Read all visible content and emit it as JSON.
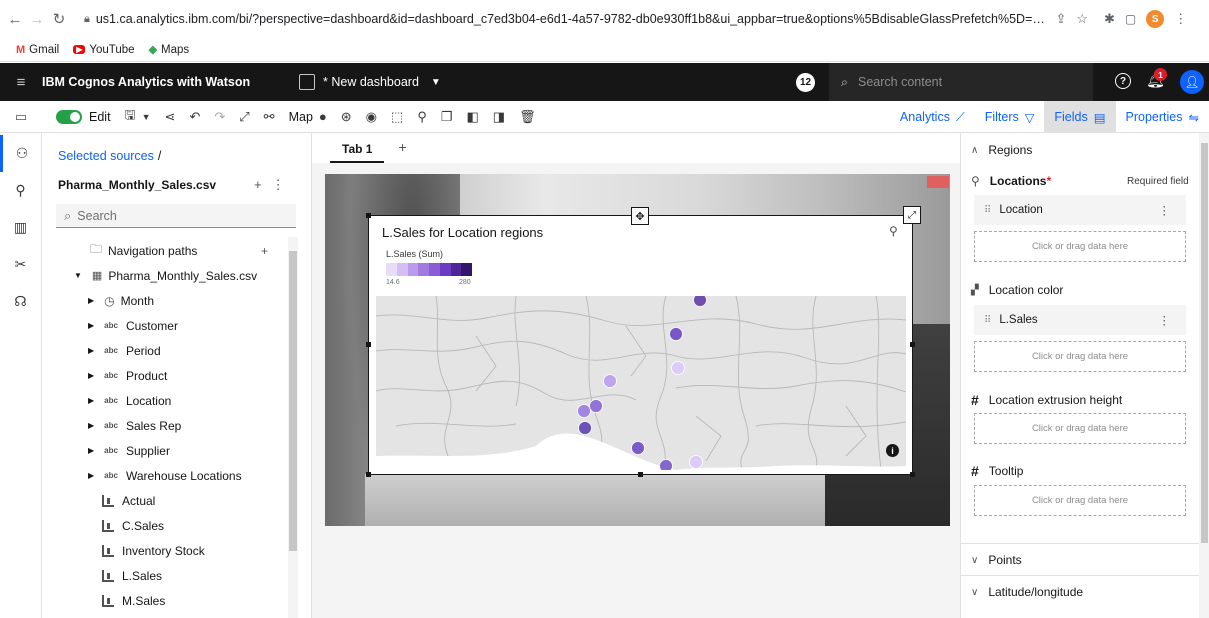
{
  "browser": {
    "url": "us1.ca.analytics.ibm.com/bi/?perspective=dashboard&id=dashboard_c7ed3b04-e6d1-4a57-9782-db0e930ff1b8&ui_appbar=true&options%5BdisableGlassPrefetch%5D=true&options%5Bcol...",
    "bookmarks": [
      {
        "icon": "M",
        "label": "Gmail",
        "color": "#ea4335"
      },
      {
        "icon": "▶",
        "label": "YouTube",
        "color": "#ff0000"
      },
      {
        "icon": "◆",
        "label": "Maps",
        "color": "#34a853"
      }
    ],
    "profile_initial": "S"
  },
  "appbar": {
    "title": "IBM Cognos Analytics with Watson",
    "dashboard_name": "* New dashboard",
    "notifications_count": "12",
    "search_placeholder": "Search content",
    "bell_badge": "1"
  },
  "toolbar": {
    "edit_label": "Edit",
    "map_label": "Map",
    "right_tabs": [
      {
        "label": "Analytics",
        "icon": "chart-line-icon",
        "active": false
      },
      {
        "label": "Filters",
        "icon": "filter-icon",
        "active": false
      },
      {
        "label": "Fields",
        "icon": "fields-icon",
        "active": true
      },
      {
        "label": "Properties",
        "icon": "settings-adjust-icon",
        "active": false
      }
    ]
  },
  "sources": {
    "selected_sources": "Selected sources",
    "file_name": "Pharma_Monthly_Sales.csv",
    "search_placeholder": "Search",
    "tree": [
      {
        "label": "Navigation paths",
        "kind": "folder",
        "indent": 48
      },
      {
        "label": "Pharma_Monthly_Sales.csv",
        "kind": "table",
        "indent": 32
      },
      {
        "label": "Month",
        "kind": "time",
        "indent": 46
      },
      {
        "label": "Customer",
        "kind": "abc",
        "indent": 46
      },
      {
        "label": "Period",
        "kind": "abc",
        "indent": 46
      },
      {
        "label": "Product",
        "kind": "abc",
        "indent": 46
      },
      {
        "label": "Location",
        "kind": "abc",
        "indent": 46
      },
      {
        "label": "Sales Rep",
        "kind": "abc",
        "indent": 46
      },
      {
        "label": "Supplier",
        "kind": "abc",
        "indent": 46
      },
      {
        "label": "Warehouse Locations",
        "kind": "abc",
        "indent": 46
      },
      {
        "label": "Actual",
        "kind": "measure",
        "indent": 60
      },
      {
        "label": "C.Sales",
        "kind": "measure",
        "indent": 60
      },
      {
        "label": "Inventory Stock",
        "kind": "measure",
        "indent": 60
      },
      {
        "label": "L.Sales",
        "kind": "measure",
        "indent": 60
      },
      {
        "label": "M.Sales",
        "kind": "measure",
        "indent": 60
      }
    ]
  },
  "canvas": {
    "tab_label": "Tab 1",
    "tab_add": "+"
  },
  "widget": {
    "title": "L.Sales for Location regions",
    "legend_label": "L.Sales (Sum)",
    "legend_min": "14.6",
    "legend_max": "280",
    "legend_colors": [
      "#e8dcf9",
      "#d4bff3",
      "#bb9bec",
      "#a07ae1",
      "#8a5cd6",
      "#6e3cc2",
      "#4f2597",
      "#33156b"
    ],
    "points": [
      {
        "id": "p1",
        "value": 280,
        "color": "#6e4fb0"
      },
      {
        "id": "p2",
        "value": 190,
        "color": "#7a56c8"
      },
      {
        "id": "p3",
        "value": 20,
        "color": "#dccbf8"
      },
      {
        "id": "p4",
        "value": 60,
        "color": "#bfa4ee"
      },
      {
        "id": "p5",
        "value": 120,
        "color": "#9274d9"
      },
      {
        "id": "p6",
        "value": 100,
        "color": "#a385e2"
      },
      {
        "id": "p7",
        "value": 230,
        "color": "#6c54b8"
      },
      {
        "id": "p8",
        "value": 170,
        "color": "#7b5bc8"
      },
      {
        "id": "p9",
        "value": 150,
        "color": "#8466cf"
      },
      {
        "id": "p10",
        "value": 25,
        "color": "#dccbf8"
      }
    ]
  },
  "fields": {
    "regions_header": "Regions",
    "locations_label": "Locations",
    "required_field": "Required field",
    "location_chip": "Location",
    "drop_hint": "Click or drag data here",
    "location_color_label": "Location color",
    "lsales_chip": "L.Sales",
    "extrusion_label": "Location extrusion height",
    "tooltip_label": "Tooltip",
    "points_label": "Points",
    "latlong_label": "Latitude/longitude"
  }
}
